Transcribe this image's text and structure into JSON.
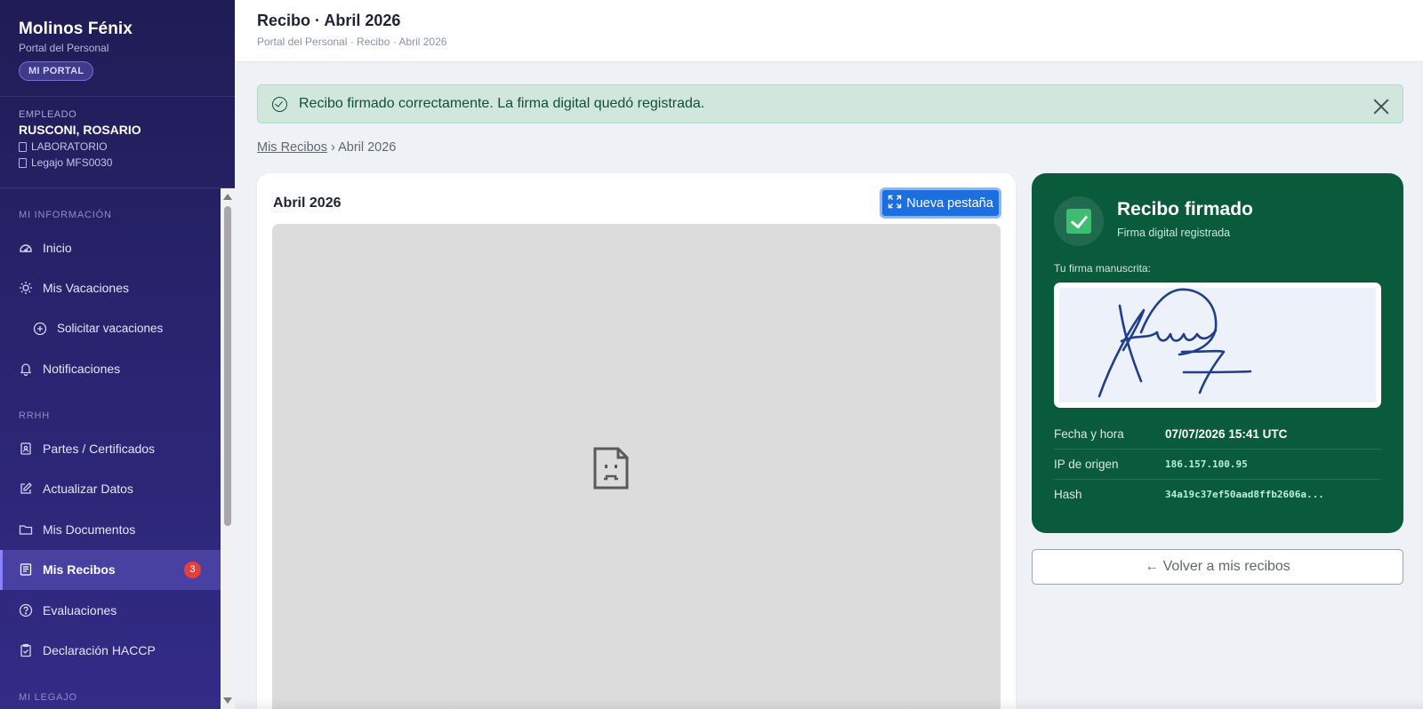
{
  "sidebar": {
    "brand_name": "Molinos Fénix",
    "brand_sub": "Portal del Personal",
    "badge": "MI PORTAL",
    "employee": {
      "label": "EMPLEADO",
      "name": "RUSCONI, ROSARIO",
      "department": "LABORATORIO",
      "legajo": "Legajo MFS0030"
    },
    "sections": [
      {
        "title": "MI INFORMACIÓN",
        "items": [
          {
            "label": "Inicio",
            "icon": "dashboard-icon"
          },
          {
            "label": "Mis Vacaciones",
            "icon": "sun-icon"
          },
          {
            "label": "Solicitar vacaciones",
            "icon": "plus-circle-icon",
            "sub": true
          },
          {
            "label": "Notificaciones",
            "icon": "bell-icon"
          }
        ]
      },
      {
        "title": "RRHH",
        "items": [
          {
            "label": "Partes / Certificados",
            "icon": "badge-icon"
          },
          {
            "label": "Actualizar Datos",
            "icon": "edit-icon"
          },
          {
            "label": "Mis Documentos",
            "icon": "folder-icon"
          },
          {
            "label": "Mis Recibos",
            "icon": "receipt-icon",
            "active": true,
            "count": "3"
          },
          {
            "label": "Evaluaciones",
            "icon": "question-circle-icon"
          },
          {
            "label": "Declaración HACCP",
            "icon": "clipboard-check-icon"
          }
        ]
      },
      {
        "title": "MI LEGAJO",
        "items": []
      }
    ]
  },
  "header": {
    "title": "Recibo · Abril 2026",
    "crumb": "Portal del Personal · Recibo · Abril 2026"
  },
  "alert": {
    "message": "Recibo firmado correctamente. La firma digital quedó registrada."
  },
  "breadcrumb": {
    "link": "Mis Recibos",
    "separator": "›",
    "current": "Abril 2026"
  },
  "pdf": {
    "title": "Abril 2026",
    "new_tab_label": "Nueva pestaña"
  },
  "signed": {
    "title": "Recibo firmado",
    "subtitle": "Firma digital registrada",
    "signature_label": "Tu firma manuscrita:",
    "rows": [
      {
        "label": "Fecha y hora",
        "value": "07/07/2026 15:41 UTC"
      },
      {
        "label": "IP de origen",
        "value": "186.157.100.95"
      },
      {
        "label": "Hash",
        "value": "34a19c37ef50aad8ffb2606a..."
      }
    ]
  },
  "back_button": "← Volver a mis recibos",
  "colors": {
    "sidebar": "#2a2470",
    "accent": "#1d6fe0",
    "signed_card": "#0a5a3c",
    "alert_bg": "#d1e7dd",
    "badge_red": "#e53e3e"
  }
}
